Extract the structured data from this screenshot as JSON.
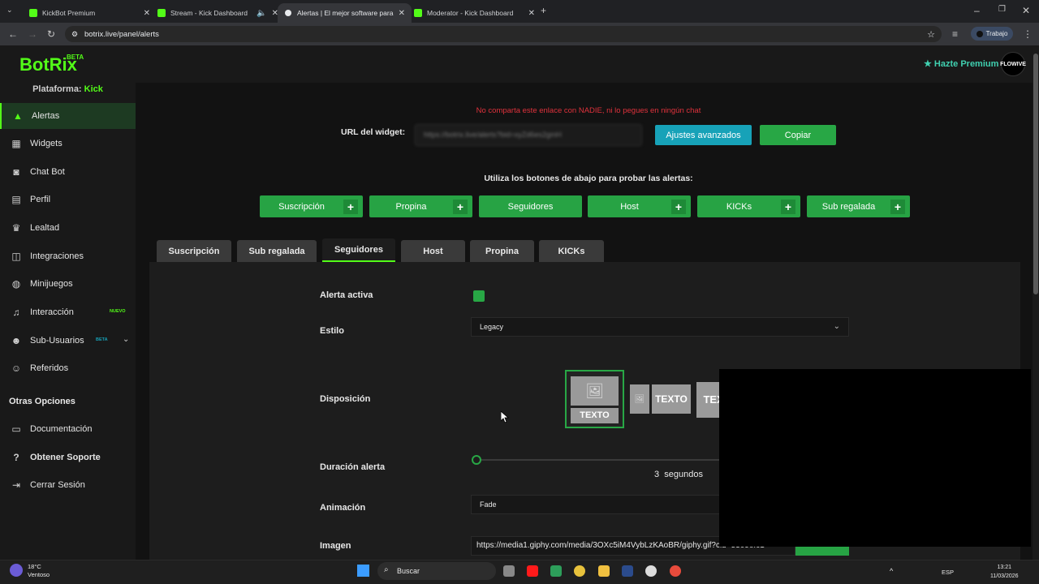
{
  "browser": {
    "tabs": [
      {
        "title": "KickBot Premium",
        "favicon": "kick-icon"
      },
      {
        "title": "Stream - Kick Dashboard",
        "favicon": "kick-icon",
        "muted": true
      },
      {
        "title": "Alertas | El mejor software para",
        "favicon": "botrix-icon",
        "active": true
      },
      {
        "title": "Moderator - Kick Dashboard",
        "favicon": "kick-icon"
      }
    ],
    "url": "botrix.live/panel/alerts",
    "profile": "Trabajo"
  },
  "app": {
    "logo": "BotRix",
    "beta": "BETA",
    "premium": "Hazte Premium",
    "avatar_text": "FLOWIVE",
    "accent": "#53fc18"
  },
  "sidebar": {
    "platform_label": "Plataforma:",
    "platform_value": "Kick",
    "items": [
      {
        "label": "Alertas",
        "icon": "warning-icon",
        "active": true
      },
      {
        "label": "Widgets",
        "icon": "grid-icon"
      },
      {
        "label": "Chat Bot",
        "icon": "robot-icon"
      },
      {
        "label": "Perfil",
        "icon": "id-card-icon"
      },
      {
        "label": "Lealtad",
        "icon": "trophy-icon"
      },
      {
        "label": "Integraciones",
        "icon": "integration-icon"
      },
      {
        "label": "Minijuegos",
        "icon": "gamepad-icon"
      },
      {
        "label": "Interacción",
        "icon": "music-icon",
        "badge": "NUEVO"
      },
      {
        "label": "Sub-Usuarios",
        "icon": "users-icon",
        "badge": "BETA"
      },
      {
        "label": "Referidos",
        "icon": "referral-icon"
      }
    ],
    "other_title": "Otras Opciones",
    "other_items": [
      {
        "label": "Documentación",
        "icon": "document-icon"
      },
      {
        "label": "Obtener Soporte",
        "icon": "help-icon"
      },
      {
        "label": "Cerrar Sesión",
        "icon": "logout-icon"
      }
    ]
  },
  "widget": {
    "warning": "No comparta este enlace con NADIE, ni lo pegues en ningún chat",
    "url_label": "URL del widget:",
    "url_value": "https://botrix.live/alerts?bid=xyZd6es2gmH",
    "advanced_button": "Ajustes avanzados",
    "copy_button": "Copiar"
  },
  "test": {
    "label": "Utiliza los botones de abajo para probar las alertas:",
    "buttons": [
      "Suscripción",
      "Propina",
      "Seguidores",
      "Host",
      "KICKs",
      "Sub regalada"
    ]
  },
  "tabs": [
    "Suscripción",
    "Sub regalada",
    "Seguidores",
    "Host",
    "Propina",
    "KICKs"
  ],
  "active_tab": "Seguidores",
  "form": {
    "active_label": "Alerta activa",
    "style_label": "Estilo",
    "style_value": "Legacy",
    "layout_label": "Disposición",
    "layout_text": "TEXTO",
    "duration_label": "Duración alerta",
    "duration_value": "3",
    "duration_unit": "segundos",
    "animation_label": "Animación",
    "animation_value": "Fade",
    "image_label": "Imagen",
    "image_value": "https://media1.giphy.com/media/3OXc5iM4VybLzKAoBR/giphy.gif?cid=5309efc1"
  },
  "taskbar": {
    "weather_temp": "18°C",
    "weather_desc": "Ventoso",
    "search": "Buscar",
    "lang": "ESP",
    "time": "13:21",
    "date": "11/03/2026"
  }
}
